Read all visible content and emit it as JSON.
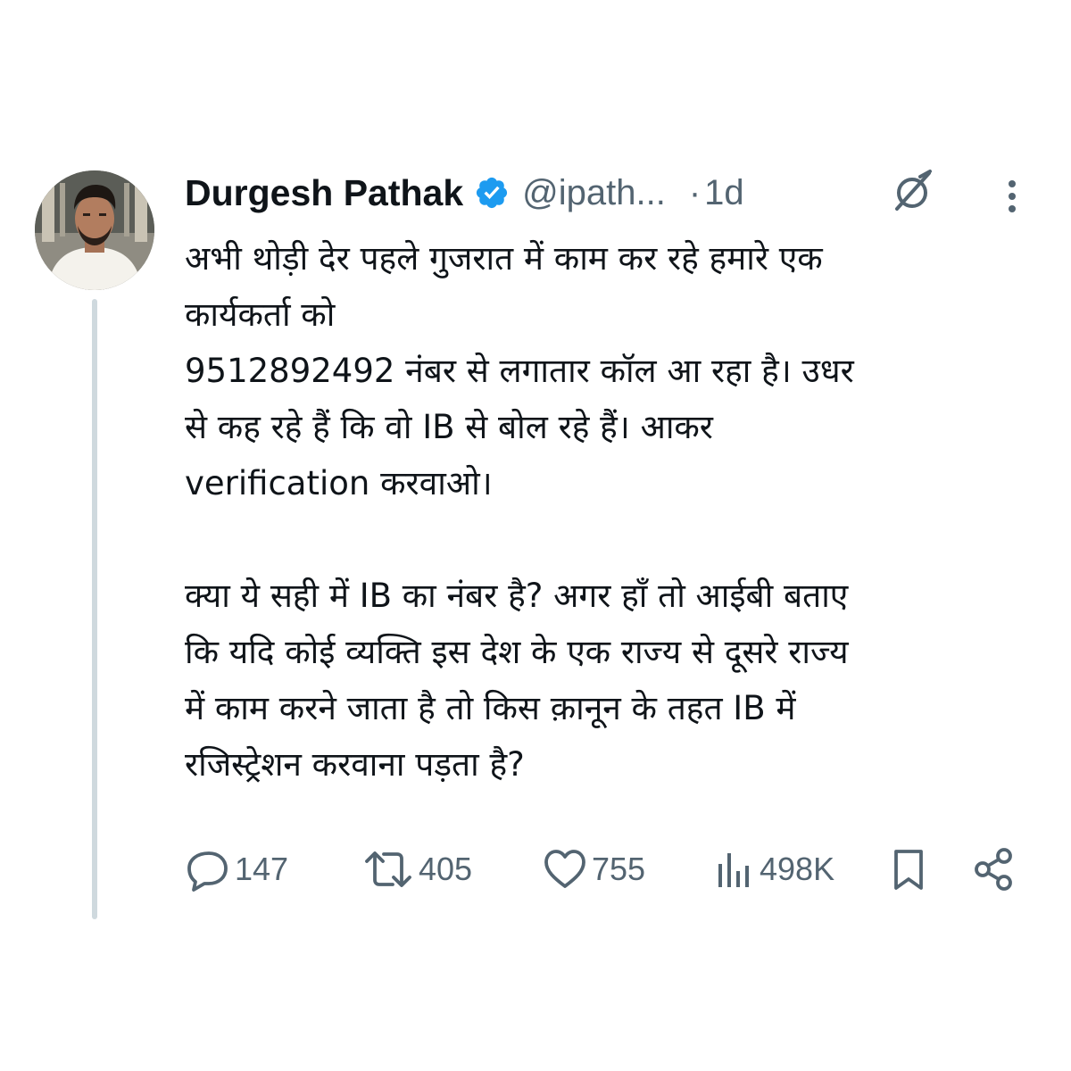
{
  "tweet": {
    "author": {
      "name": "Durgesh Pathak",
      "handle": "@ipath...",
      "verified": true,
      "verified_color": "#1d9bf0"
    },
    "separator": "·",
    "time": "1d",
    "text_paragraphs": [
      "अभी थोड़ी देर पहले गुजरात में काम कर रहे हमारे एक\nकार्यकर्ता को\n9512892492 नंबर से लगातार कॉल आ रहा है। उधर\nसे कह रहे हैं कि वो IB से बोल रहे हैं। आकर\nverification करवाओ।",
      "क्या ये सही में IB का नंबर है? अगर हाँ तो आईबी बताए\nकि यदि कोई व्यक्ति इस देश के एक राज्य से दूसरे राज्य\nमें काम करने जाता है तो किस क़ानून के तहत IB में\nरजिस्ट्रेशन करवाना पड़ता है?"
    ],
    "stats": {
      "replies": "147",
      "retweets": "405",
      "likes": "755",
      "views": "498K"
    },
    "icons": {
      "reply": "reply-icon",
      "retweet": "retweet-icon",
      "like": "heart-icon",
      "views": "views-icon",
      "bookmark": "bookmark-icon",
      "share": "share-icon",
      "grok": "grok-icon",
      "more": "more-icon"
    },
    "colors": {
      "text": "#0f1419",
      "secondary": "#536471",
      "thread_line": "#cfd9de"
    }
  }
}
